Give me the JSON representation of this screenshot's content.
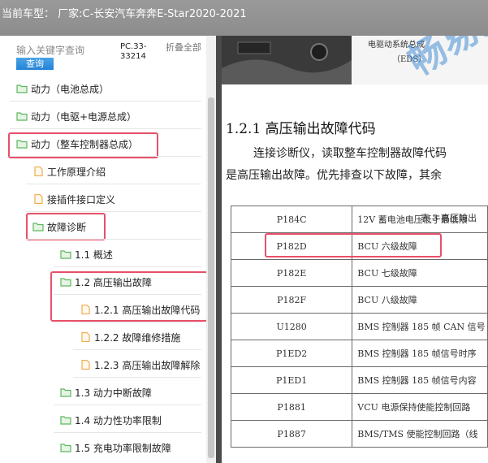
{
  "window": {
    "title": "当前车型：  厂家:C-长安汽车奔奔E-Star2020-2021"
  },
  "search": {
    "placeholder": "输入关键字查询",
    "button_label": "查询",
    "pc_code": "PC.33-33214",
    "collapse_all": "折叠全部"
  },
  "tree": [
    {
      "label": "动力（电池总成）",
      "type": "folder",
      "level": 0
    },
    {
      "label": "动力（电驱+电源总成）",
      "type": "folder",
      "level": 0
    },
    {
      "label": "动力（整车控制器总成）",
      "type": "folder",
      "level": 0,
      "highlighted": true
    },
    {
      "label": "工作原理介绍",
      "type": "file",
      "level": 1
    },
    {
      "label": "接插件接口定义",
      "type": "file",
      "level": 1
    },
    {
      "label": "故障诊断",
      "type": "folder",
      "level": 1,
      "highlighted": true
    },
    {
      "label": "1.1 概述",
      "type": "folder",
      "level": 2
    },
    {
      "label": "1.2 高压输出故障",
      "type": "folder",
      "level": 2,
      "highlighted": true
    },
    {
      "label": "1.2.1 高压输出故障代码",
      "type": "file",
      "level": 3,
      "highlighted": true
    },
    {
      "label": "1.2.2 故障维修措施",
      "type": "file",
      "level": 3
    },
    {
      "label": "1.2.3 高压输出故障解除",
      "type": "file",
      "level": 3
    },
    {
      "label": "1.3 动力中断故障",
      "type": "folder",
      "level": 2
    },
    {
      "label": "1.4 动力性功率限制",
      "type": "folder",
      "level": 2
    },
    {
      "label": "1.5 充电功率限制故障",
      "type": "folder",
      "level": 2
    }
  ],
  "document": {
    "figure_caption": "电驱动系统总成",
    "figure_caption_abbr": "（EDS）",
    "watermark": "畅易汽",
    "section_title": "1.2.1  高压输出故障代码",
    "paragraph_line1": "连接诊断仪，读取整车控制器故障代码",
    "paragraph_line2": "是高压输出故障。优先排查以下故障，其余",
    "table_caption": "表 3  高压输出",
    "fault_table": [
      {
        "code": "P184C",
        "desc": "12V 蓄电池电压低于最低限"
      },
      {
        "code": "P182D",
        "desc": "BCU 六级故障",
        "highlighted": true
      },
      {
        "code": "P182E",
        "desc": "BCU 七级故障"
      },
      {
        "code": "P182F",
        "desc": "BCU 八级故障"
      },
      {
        "code": "U1280",
        "desc": "BMS 控制器 185 帧 CAN 信号"
      },
      {
        "code": "P1ED2",
        "desc": "BMS 控制器 185 帧信号时序"
      },
      {
        "code": "P1ED1",
        "desc": "BMS 控制器 185 帧信号内容"
      },
      {
        "code": "P1881",
        "desc": "VCU 电源保持使能控制回路"
      },
      {
        "code": "P1887",
        "desc": "BMS/TMS 使能控制回路（线"
      }
    ]
  },
  "colors": {
    "highlight_box": "#e8506a",
    "folder_icon": "#5cb85c",
    "file_icon": "#f0ad4e",
    "search_button": "#2383d6"
  },
  "icons": {
    "folder": "folder-open-icon",
    "file": "document-icon"
  }
}
